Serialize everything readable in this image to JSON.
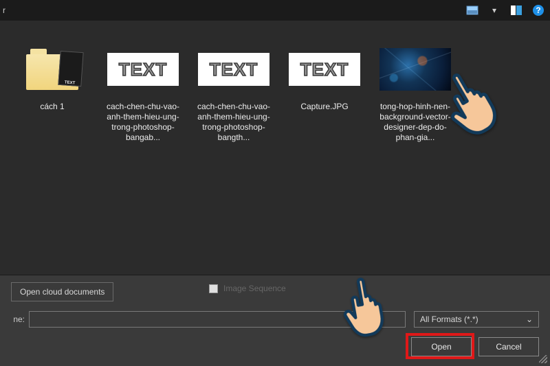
{
  "titleFrag": "r",
  "toolbar": {},
  "files": [
    {
      "name": "cách 1",
      "kind": "folder"
    },
    {
      "name": "cach-chen-chu-vao-anh-them-hieu-ung-trong-photoshop-bangab...",
      "kind": "text"
    },
    {
      "name": "cach-chen-chu-vao-anh-them-hieu-ung-trong-photoshop-bangth...",
      "kind": "text"
    },
    {
      "name": "Capture.JPG",
      "kind": "text"
    },
    {
      "name": "tong-hop-hinh-nen-background-vector-designer-dep-do-phan-gia...",
      "kind": "image"
    }
  ],
  "cloud_button": "Open cloud documents",
  "image_sequence_label": "Image Sequence",
  "filename_label": "ne:",
  "filename_value": "",
  "format_selected": "All Formats (*.*)",
  "open_label": "Open",
  "cancel_label": "Cancel",
  "text_thumb_label": "TEXT"
}
